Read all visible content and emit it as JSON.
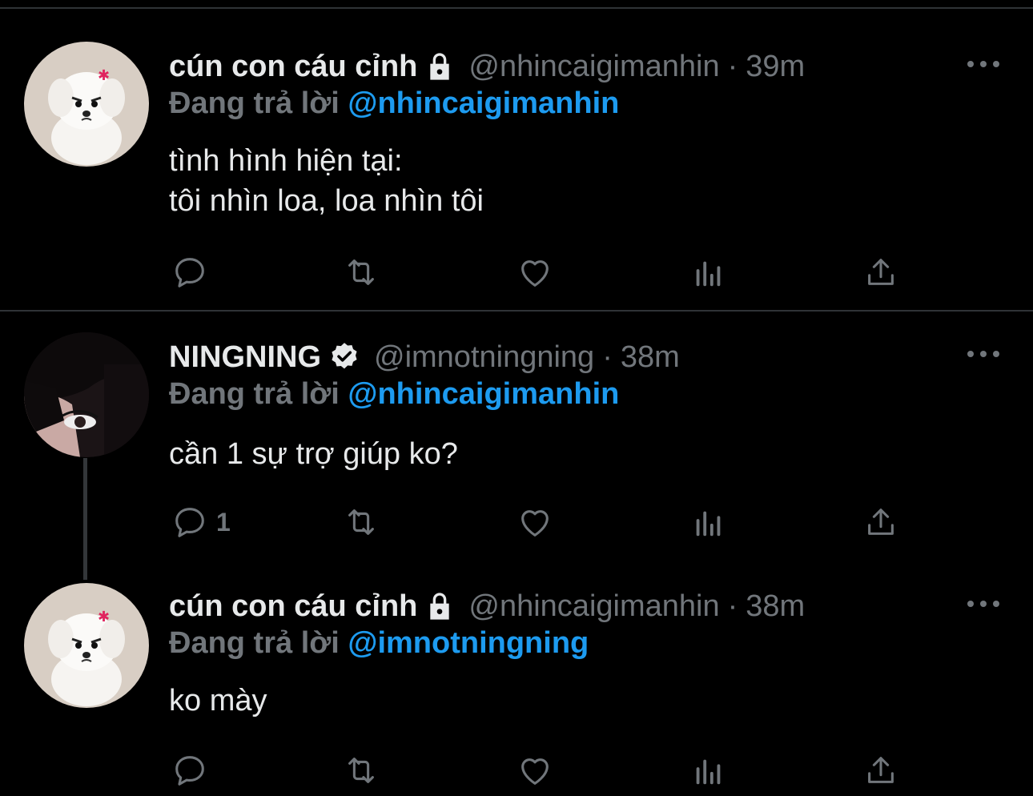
{
  "tweets": [
    {
      "display_name": "cún con cáu cỉnh",
      "badge": "lock-icon",
      "handle": "@nhincaigimanhin",
      "time": "39m",
      "reply_prefix": "Đang trả lời",
      "reply_to": "@nhincaigimanhin",
      "text": "tình hình hiện tại:\ntôi nhìn loa, loa nhìn tôi",
      "reply_count": ""
    },
    {
      "display_name": "NINGNING",
      "badge": "verified-icon",
      "handle": "@imnotningning",
      "time": "38m",
      "reply_prefix": "Đang trả lời",
      "reply_to": "@nhincaigimanhin",
      "text": "cần 1 sự trợ giúp ko?",
      "reply_count": "1"
    },
    {
      "display_name": "cún con cáu cỉnh",
      "badge": "lock-icon",
      "handle": "@nhincaigimanhin",
      "time": "38m",
      "reply_prefix": "Đang trả lời",
      "reply_to": "@imnotningning",
      "text": "ko mày",
      "reply_count": ""
    }
  ],
  "separator": "·",
  "colors": {
    "background": "#000000",
    "text": "#e7e9ea",
    "muted": "#71767b",
    "accent": "#1d9bf0",
    "divider": "#2f3336"
  }
}
